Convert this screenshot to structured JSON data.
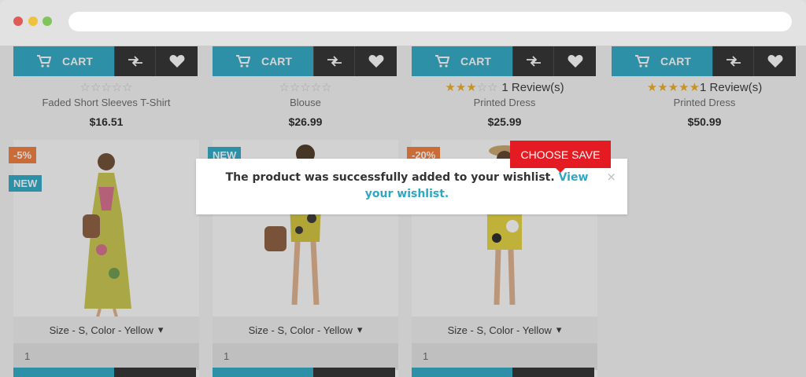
{
  "cart_label": "CART",
  "products_top": [
    {
      "name": "Faded Short Sleeves T-Shirt",
      "price": "$16.51",
      "rating": 0,
      "reviews": ""
    },
    {
      "name": "Blouse",
      "price": "$26.99",
      "rating": 0,
      "reviews": ""
    },
    {
      "name": "Printed Dress",
      "price": "$25.99",
      "rating": 3,
      "reviews": "1 Review(s)"
    },
    {
      "name": "Printed Dress",
      "price": "$50.99",
      "rating": 5,
      "reviews": "1 Review(s)"
    }
  ],
  "products_bottom": [
    {
      "badges": [
        "-5%",
        "NEW"
      ],
      "variant": "Size - S, Color - Yellow",
      "qty": "1"
    },
    {
      "badges": [
        "NEW"
      ],
      "variant": "Size - S, Color - Yellow",
      "qty": "1"
    },
    {
      "badges": [
        "-20%"
      ],
      "variant": "Size - S, Color - Yellow",
      "qty": "1"
    }
  ],
  "modal": {
    "message": "The product was successfully added to your wishlist.",
    "link_text": "View your wishlist.",
    "close": "×"
  },
  "tooltip": "CHOOSE SAVE",
  "colors": {
    "accent": "#2aa8c6",
    "dark": "#2b2b2b",
    "sale": "#f27a37",
    "tooltip": "#e41b23",
    "star": "#f0ac1c"
  }
}
